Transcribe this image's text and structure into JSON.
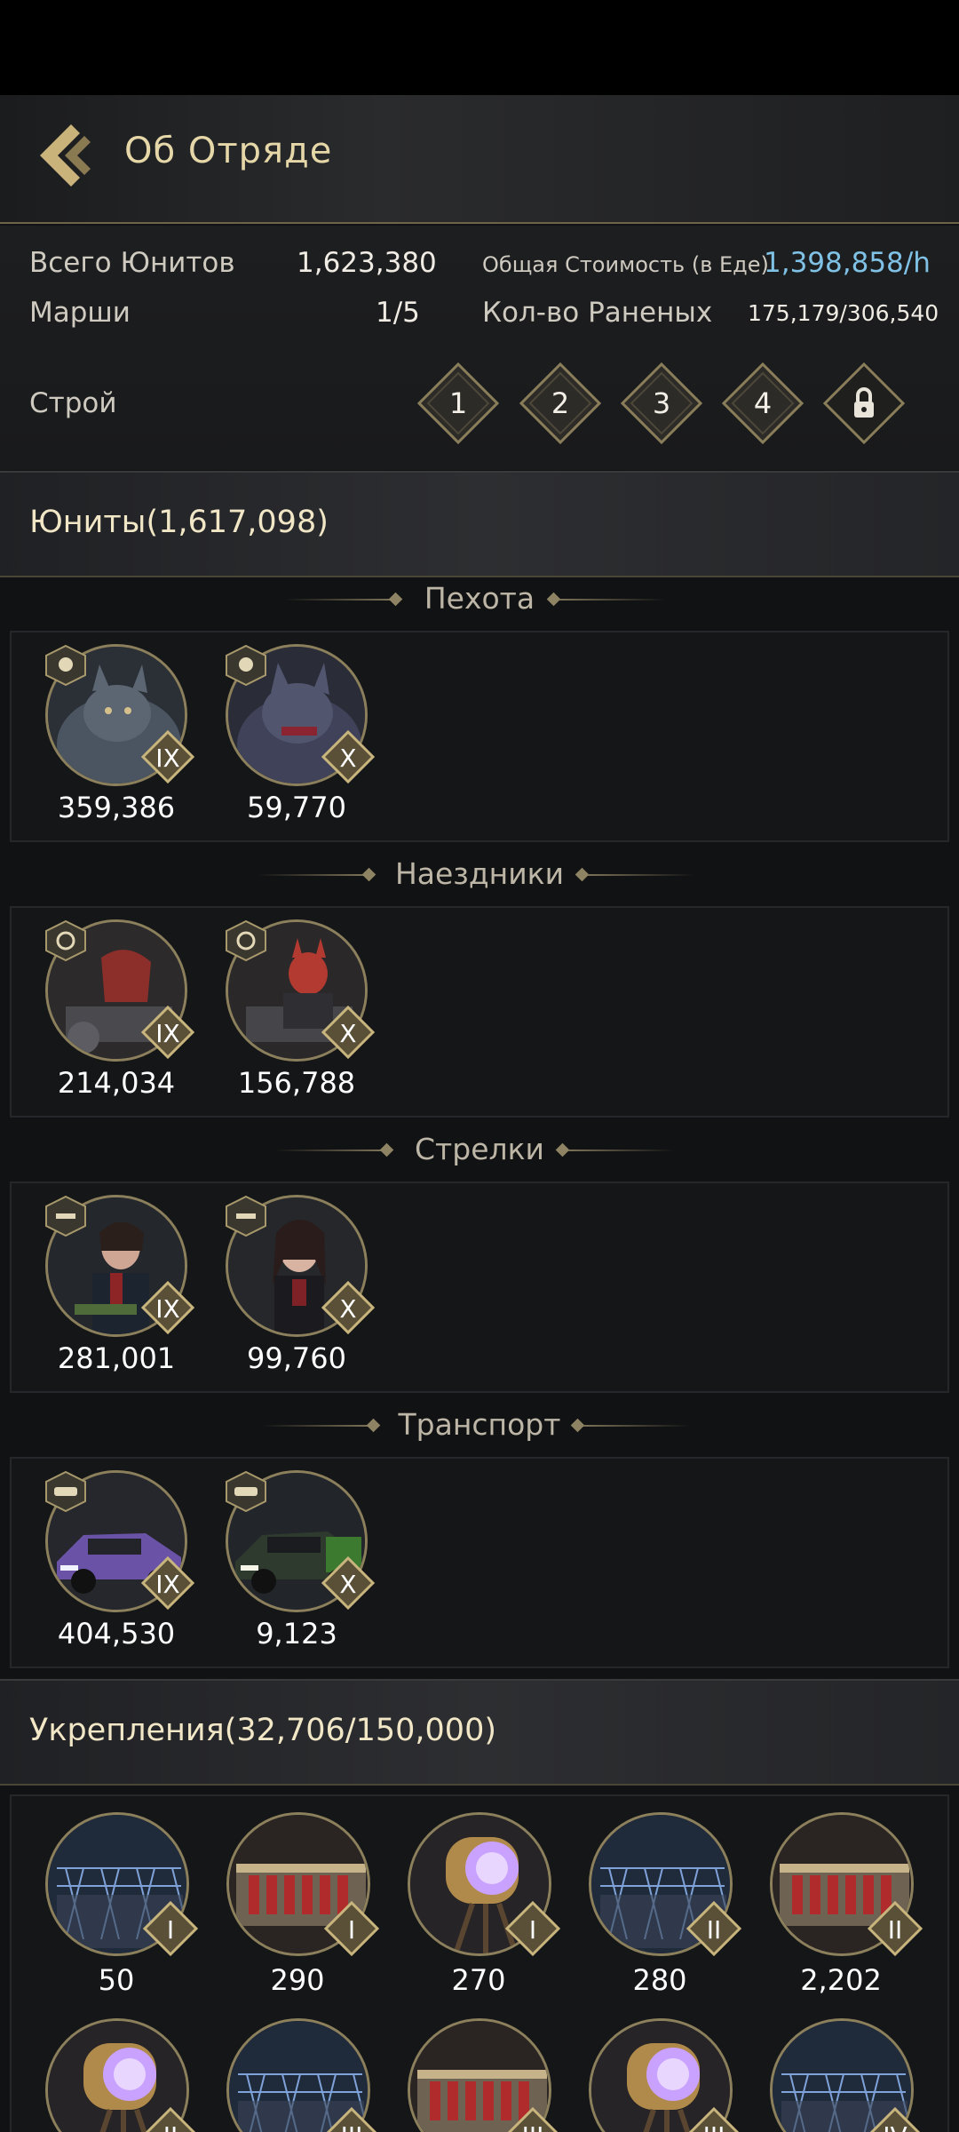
{
  "header": {
    "title": "Об Отряде"
  },
  "stats": {
    "total_units_label": "Всего Юнитов",
    "total_units_value": "1,623,380",
    "marches_label": "Марши",
    "marches_value": "1/5",
    "total_cost_label": "Общая Стоимость (в Еде)",
    "total_cost_value": "1,398,858/h",
    "wounded_label": "Кол-во Раненых",
    "wounded_value": "175,179/306,540",
    "formation_label": "Строй",
    "formations": [
      "1",
      "2",
      "3",
      "4"
    ]
  },
  "units_section": {
    "title": "Юниты(1,617,098)"
  },
  "groups": [
    {
      "title": "Пехота",
      "units": [
        {
          "tier": "IX",
          "count": "359,386"
        },
        {
          "tier": "X",
          "count": "59,770"
        }
      ]
    },
    {
      "title": "Наездники",
      "units": [
        {
          "tier": "IX",
          "count": "214,034"
        },
        {
          "tier": "X",
          "count": "156,788"
        }
      ]
    },
    {
      "title": "Стрелки",
      "units": [
        {
          "tier": "IX",
          "count": "281,001"
        },
        {
          "tier": "X",
          "count": "99,760"
        }
      ]
    },
    {
      "title": "Транспорт",
      "units": [
        {
          "tier": "IX",
          "count": "404,530"
        },
        {
          "tier": "X",
          "count": "9,123"
        }
      ]
    }
  ],
  "fortifications_section": {
    "title": "Укрепления(32,706/150,000)"
  },
  "fortifications": [
    {
      "icon": "barbed-fence-icon",
      "tier": "I",
      "count": "50"
    },
    {
      "icon": "ammo-crate-icon",
      "tier": "I",
      "count": "290"
    },
    {
      "icon": "searchlight-icon",
      "tier": "I",
      "count": "270"
    },
    {
      "icon": "barbed-fence-icon",
      "tier": "II",
      "count": "280"
    },
    {
      "icon": "ammo-crate-icon",
      "tier": "II",
      "count": "2,202"
    },
    {
      "icon": "searchlight-icon",
      "tier": "II",
      "count": ""
    },
    {
      "icon": "barbed-fence-icon",
      "tier": "III",
      "count": ""
    },
    {
      "icon": "ammo-crate-icon",
      "tier": "III",
      "count": ""
    },
    {
      "icon": "searchlight-icon",
      "tier": "III",
      "count": ""
    },
    {
      "icon": "barbed-fence-icon",
      "tier": "IV",
      "count": ""
    }
  ],
  "colors": {
    "accent_gold": "#c9b37a",
    "value_blue": "#7fc2e6",
    "title_cream": "#e6d7a8"
  }
}
